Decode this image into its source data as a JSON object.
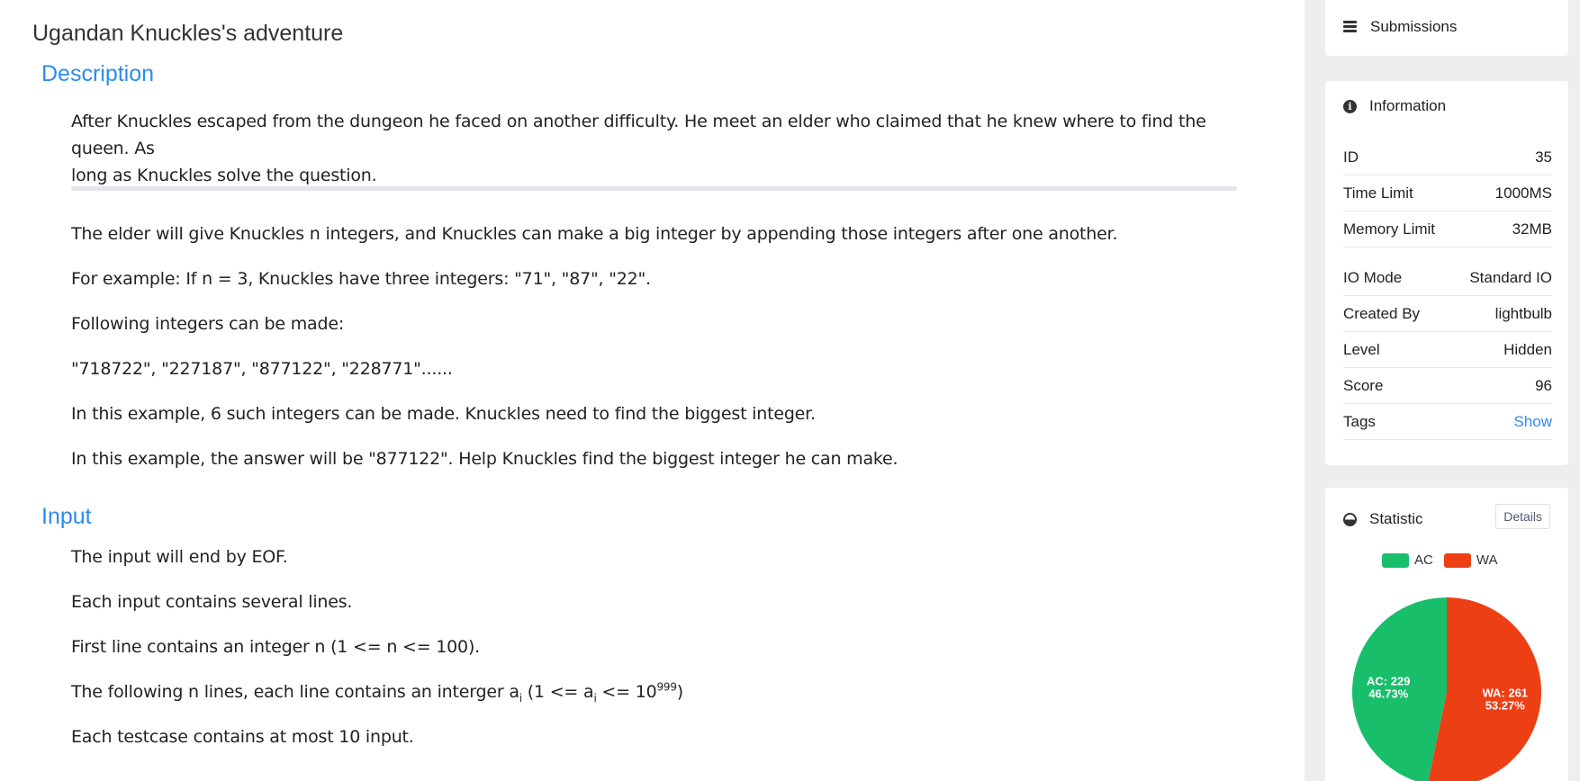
{
  "problem": {
    "title": "Ugandan Knuckles's adventure"
  },
  "description": {
    "heading": "Description",
    "intro_line1": "After Knuckles escaped from the dungeon he faced on another difficulty. He meet an elder who claimed that he knew where to find the queen. As",
    "intro_line2": "long as Knuckles solve the question.",
    "p1_a": "The elder will give Knuckles ",
    "p1_n": "n",
    "p1_b": " integers, and Knuckles can ",
    "p1_c": "make a big integer by appending those integers after one another.",
    "p2_a": "For example: If ",
    "p2_n": "n = 3",
    "p2_b": ", Knuckles have three integers: \"71\", \"87\", \"22\".",
    "p3": "Following integers can be made:",
    "p4": "\"718722\", \"227187\", \"877122\", \"228771\"......",
    "p5_a": "In this example, 6 such integers can be made. Knuckles need to ",
    "p5_b": "find the biggest integer.",
    "p6": "In this example, the answer will be \"877122\". Help Knuckles find the biggest integer he can make."
  },
  "input": {
    "heading": "Input",
    "l1": "The input will end by EOF.",
    "l2": "Each input contains several lines.",
    "l3_a": "First line contains an integer ",
    "l3_n": "n",
    "l3_b": " (1 <= ",
    "l3_n2": "n",
    "l3_c": " <= 100).",
    "l4_a": "The following ",
    "l4_n": "n",
    "l4_b": " lines, each line contains an interger ",
    "l4_a1": "a",
    "l4_sub1": "i",
    "l4_c": " (1 <= ",
    "l4_a2": "a",
    "l4_sub2": "i",
    "l4_d": " <= 10",
    "l4_sup": "999",
    "l4_e": ")",
    "l5": "Each testcase contains at most 10 input."
  },
  "sidebar": {
    "submissions_label": "Submissions",
    "information": {
      "title": "Information",
      "rows": [
        {
          "label": "ID",
          "value": "35"
        },
        {
          "label": "Time Limit",
          "value": "1000MS"
        },
        {
          "label": "Memory Limit",
          "value": "32MB"
        },
        {
          "label": "IO Mode",
          "value": "Standard IO"
        },
        {
          "label": "Created By",
          "value": "lightbulb"
        },
        {
          "label": "Level",
          "value": "Hidden"
        },
        {
          "label": "Score",
          "value": "96"
        },
        {
          "label": "Tags",
          "value": "Show"
        }
      ]
    },
    "statistic": {
      "title": "Statistic",
      "details_label": "Details"
    }
  },
  "chart_data": {
    "type": "pie",
    "series": [
      {
        "name": "AC",
        "value": 229,
        "percent": "46.73%",
        "color": "#19be6b"
      },
      {
        "name": "WA",
        "value": 261,
        "percent": "53.27%",
        "color": "#ed3f14"
      }
    ],
    "legend_position": "top",
    "labels": [
      "AC: 229",
      "46.73%",
      "WA: 261",
      "53.27%"
    ]
  }
}
